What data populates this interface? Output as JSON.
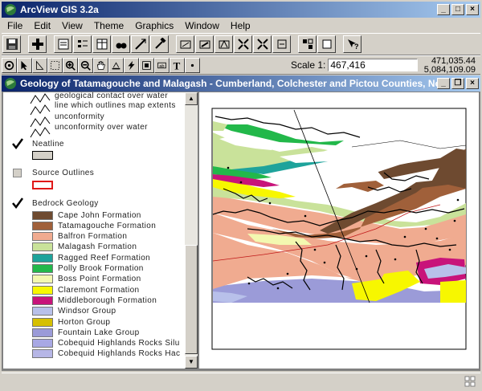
{
  "app": {
    "title": "ArcView GIS 3.2a"
  },
  "menu": [
    "File",
    "Edit",
    "View",
    "Theme",
    "Graphics",
    "Window",
    "Help"
  ],
  "toolbar": {
    "scale_label": "Scale 1:",
    "scale_value": "467,416",
    "coord_x": "471,035.44",
    "coord_y": "5,084,109.09"
  },
  "view": {
    "title": "Geology of Tatamagouche and Malagash - Cumberland, Colchester and Pictou Counties, No..."
  },
  "toc": {
    "line_items": [
      "geological contact over water",
      "line which outlines map extents",
      "unconformity",
      "unconformity over water"
    ],
    "neatline": {
      "label": "Neatline",
      "checked": true
    },
    "source_outlines": {
      "label": "Source Outlines",
      "checked": false
    },
    "bedrock": {
      "label": "Bedrock Geology",
      "checked": true,
      "classes": [
        {
          "label": "Cape John Formation",
          "color": "#6e4a30"
        },
        {
          "label": "Tatamagouche Formation",
          "color": "#a0603a"
        },
        {
          "label": "Balfron Formation",
          "color": "#f0ab90"
        },
        {
          "label": "Malagash Formation",
          "color": "#c9e29a"
        },
        {
          "label": "Ragged Reef Formation",
          "color": "#1ea39b"
        },
        {
          "label": "Polly Brook Formation",
          "color": "#22b84a"
        },
        {
          "label": "Boss Point Formation",
          "color": "#f3f8b0"
        },
        {
          "label": "Claremont Formation",
          "color": "#f7f700"
        },
        {
          "label": "Middleborough Formation",
          "color": "#c8137a"
        },
        {
          "label": "Windsor Group",
          "color": "#b8c0ea"
        },
        {
          "label": "Horton Group",
          "color": "#d6c000"
        },
        {
          "label": "Fountain Lake Group",
          "color": "#9b9bd8"
        },
        {
          "label": "Cobequid Highlands Rocks Silu",
          "color": "#a8a8e4"
        },
        {
          "label": "Cobequid Highlands Rocks Hac",
          "color": "#b6b6e6"
        }
      ]
    }
  },
  "colors": {
    "title_active": "#0a246a",
    "title_gradient_end": "#a6caf0",
    "face": "#d4d0c8"
  }
}
